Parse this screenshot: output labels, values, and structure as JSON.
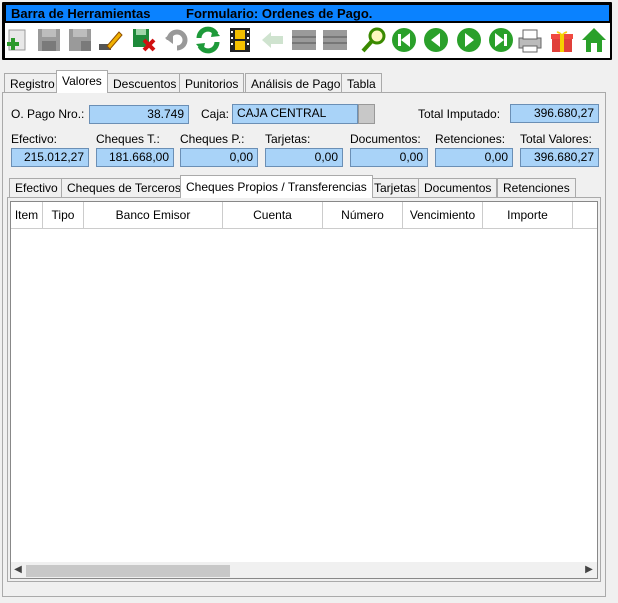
{
  "toolbar": {
    "title": "Barra de Herramientas",
    "form_title": "Formulario: Ordenes de Pago.",
    "icons": [
      "add-icon",
      "save-icon",
      "save-as-icon",
      "edit-icon",
      "delete-icon",
      "undo-icon",
      "refresh-icon",
      "film-icon",
      "back-icon",
      "list-icon",
      "list2-icon",
      "search-icon",
      "first-icon",
      "prev-icon",
      "next-icon",
      "last-icon",
      "print-icon",
      "gift-icon",
      "home-icon"
    ]
  },
  "main_tabs": [
    {
      "label": "Registro"
    },
    {
      "label": "Valores"
    },
    {
      "label": "Descuentos"
    },
    {
      "label": "Punitorios"
    },
    {
      "label": "Análisis de Pago"
    },
    {
      "label": "Tabla"
    }
  ],
  "form": {
    "opago_label": "O. Pago Nro.:",
    "opago_value": "38.749",
    "caja_label": "Caja:",
    "caja_value": "CAJA CENTRAL",
    "total_imputado_label": "Total Imputado:",
    "total_imputado_value": "396.680,27"
  },
  "totals": [
    {
      "label": "Efectivo:",
      "value": "215.012,27"
    },
    {
      "label": "Cheques T.:",
      "value": "181.668,00"
    },
    {
      "label": "Cheques P.:",
      "value": "0,00"
    },
    {
      "label": "Tarjetas:",
      "value": "0,00"
    },
    {
      "label": "Documentos:",
      "value": "0,00"
    },
    {
      "label": "Retenciones:",
      "value": "0,00"
    },
    {
      "label": "Total Valores:",
      "value": "396.680,27"
    }
  ],
  "sub_tabs": [
    {
      "label": "Efectivo"
    },
    {
      "label": "Cheques de Terceros"
    },
    {
      "label": "Cheques Propios / Transferencias"
    },
    {
      "label": "Tarjetas"
    },
    {
      "label": "Documentos"
    },
    {
      "label": "Retenciones"
    }
  ],
  "grid": {
    "columns": [
      "Item",
      "Tipo",
      "Banco Emisor",
      "Cuenta",
      "Número",
      "Vencimiento",
      "Importe"
    ]
  },
  "colors": {
    "title_bar": "#0a82ff",
    "field_bg": "#a9d3f8"
  }
}
